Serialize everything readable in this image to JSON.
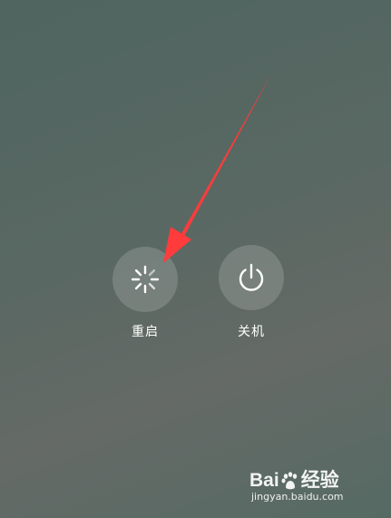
{
  "power_menu": {
    "reboot_label": "重启",
    "shutdown_label": "关机",
    "reboot_icon": "spinner-icon",
    "shutdown_icon": "power-icon"
  },
  "annotation": {
    "arrow_color": "#ff3b3b"
  },
  "watermark": {
    "logo_left": "Bai",
    "logo_right": "经验",
    "site": "jingyan.baidu.com"
  }
}
